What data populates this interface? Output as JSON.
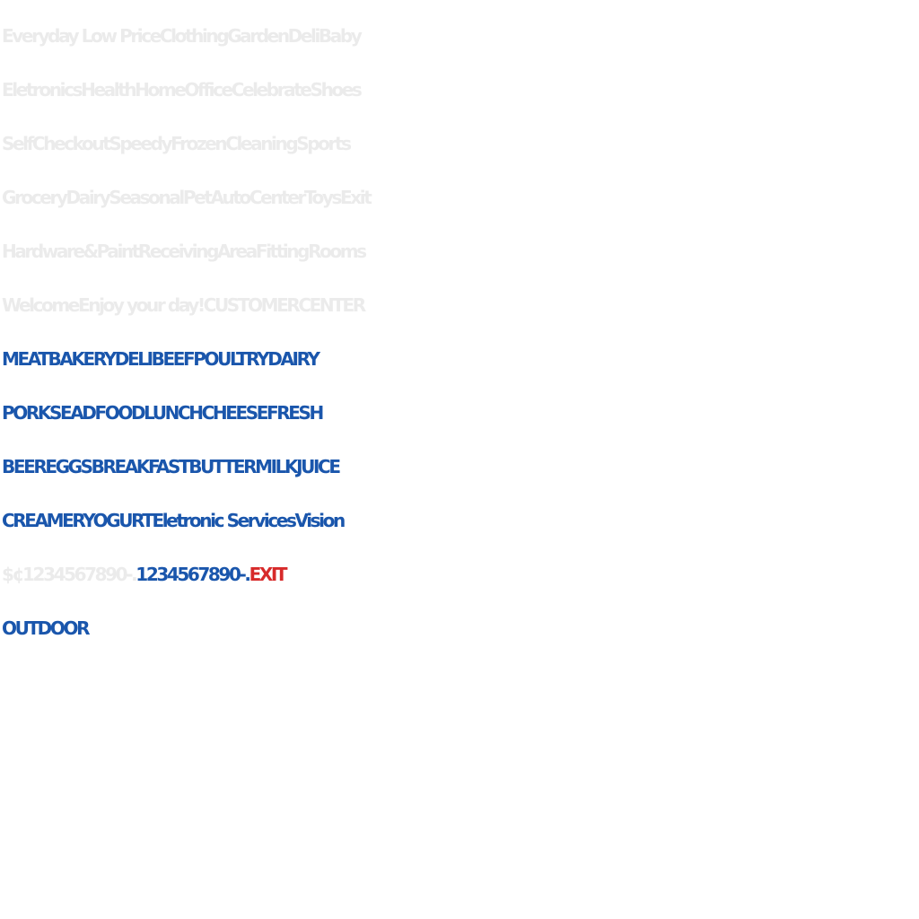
{
  "lines": [
    {
      "segments": [
        {
          "text": "Everyday Low PriceClothingGardenDeliBaby",
          "tone": "gray"
        }
      ]
    },
    {
      "segments": [
        {
          "text": "EletronicsHealthHomeOfficeCelebrateShoes",
          "tone": "gray"
        }
      ]
    },
    {
      "segments": [
        {
          "text": "SelfCheckoutSpeedyFrozenCleaningSports",
          "tone": "gray"
        }
      ]
    },
    {
      "segments": [
        {
          "text": "GroceryDairySeasonalPetAutoCenterToysExit",
          "tone": "gray"
        }
      ]
    },
    {
      "segments": [
        {
          "text": "Hardware&PaintReceivingAreaFittingRooms",
          "tone": "gray"
        }
      ]
    },
    {
      "segments": [
        {
          "text": "WelcomeEnjoy your day!CUSTOMERCENTER",
          "tone": "gray"
        }
      ]
    },
    {
      "segments": [
        {
          "text": "MEATBAKERYDELIBEEFPOULTRYDAIRY",
          "tone": "blue"
        }
      ]
    },
    {
      "segments": [
        {
          "text": "PORKSEADFOODLUNCHCHEESEFRESH",
          "tone": "blue"
        }
      ]
    },
    {
      "segments": [
        {
          "text": "BEEREGGSBREAKFASTBUTTERMILKJUICE",
          "tone": "blue"
        }
      ]
    },
    {
      "segments": [
        {
          "text": "CREAMERYOGURTEletronic ServicesVision",
          "tone": "blue"
        }
      ]
    },
    {
      "segments": [
        {
          "text": "$¢1234567890-.",
          "tone": "gray"
        },
        {
          "text": "1234567890-.",
          "tone": "blue"
        },
        {
          "text": "EXIT",
          "tone": "red"
        }
      ]
    },
    {
      "segments": [
        {
          "text": "OUTDOOR",
          "tone": "blue"
        }
      ]
    }
  ],
  "colors": {
    "gray": "#ebebeb",
    "blue": "#1a56ac",
    "red": "#d72a2a"
  }
}
